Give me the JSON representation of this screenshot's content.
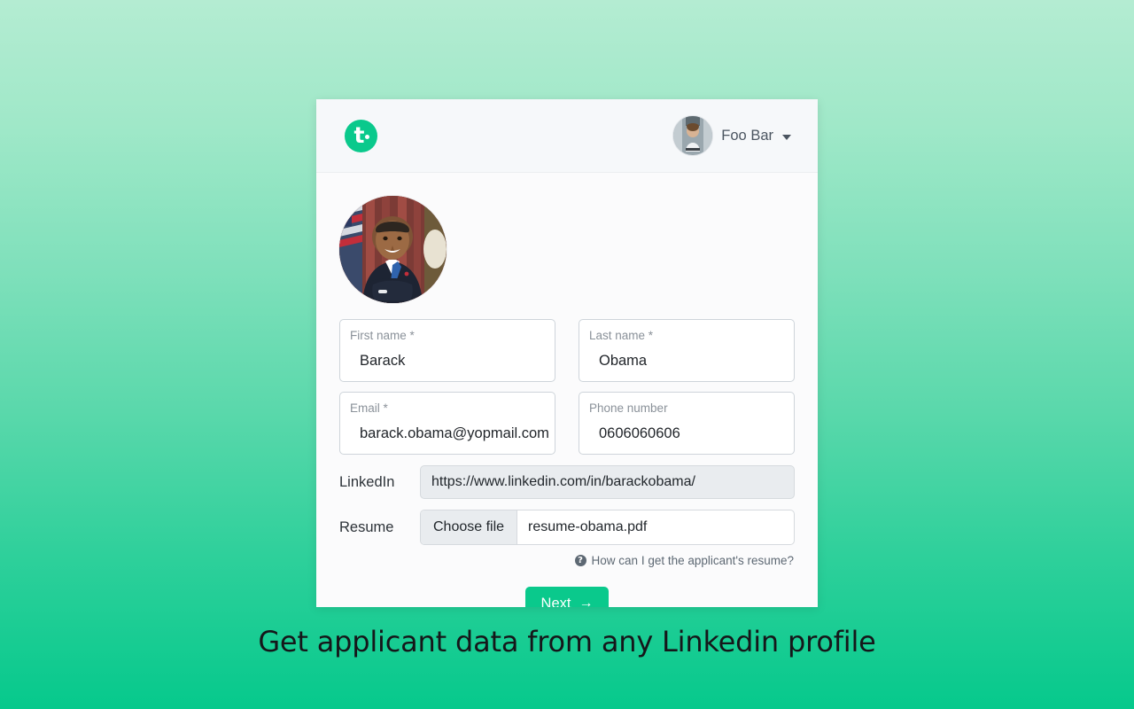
{
  "header": {
    "logo_icon": "brand-t-logo-icon",
    "user_name": "Foo Bar",
    "caret_icon": "chevron-down-icon",
    "avatar_alt": "user-avatar"
  },
  "profile": {
    "photo_alt": "applicant-portrait"
  },
  "form": {
    "fields": [
      {
        "label": "First name *",
        "value": "Barack",
        "name": "first-name"
      },
      {
        "label": "Last name *",
        "value": "Obama",
        "name": "last-name"
      },
      {
        "label": "Email *",
        "value": "barack.obama@yopmail.com",
        "name": "email"
      },
      {
        "label": "Phone number",
        "value": "0606060606",
        "name": "phone-number"
      }
    ],
    "linkedin": {
      "label": "LinkedIn",
      "value": "https://www.linkedin.com/in/barackobama/"
    },
    "resume": {
      "label": "Resume",
      "choose_file_label": "Choose file",
      "file_name": "resume-obama.pdf"
    },
    "help": {
      "icon": "question-mark-icon",
      "text": "How can I get the applicant's resume?"
    },
    "next_button": {
      "label": "Next",
      "arrow": "→"
    }
  },
  "caption": {
    "text": "Get applicant data from any Linkedin profile"
  },
  "colors": {
    "brand_green": "#0ac98c",
    "background_top": "#b4ecd2",
    "background_bottom": "#06c98c",
    "card_background": "#fbfbfc",
    "header_background": "#f6f8fa"
  }
}
